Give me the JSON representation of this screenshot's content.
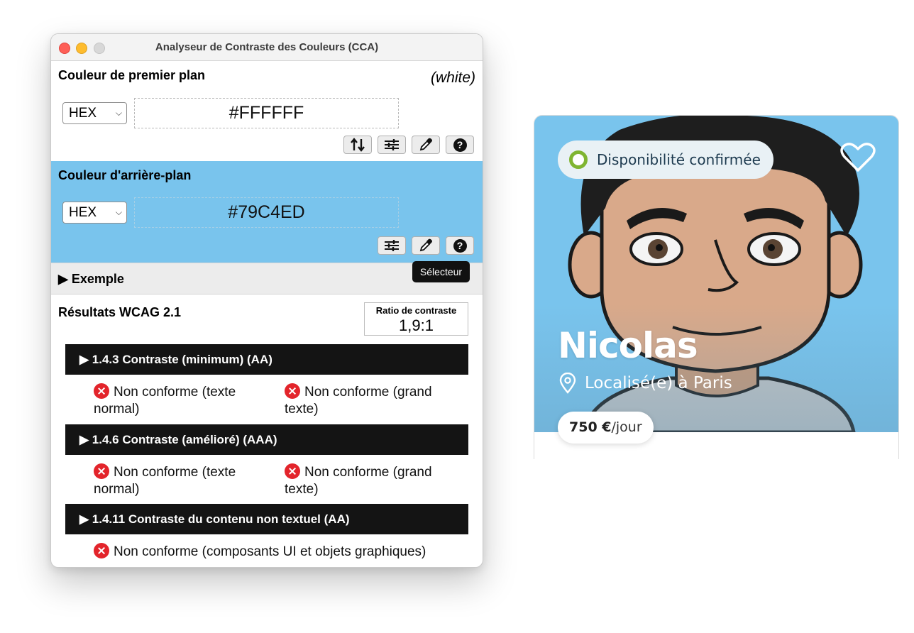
{
  "window": {
    "title": "Analyseur de Contraste des Couleurs (CCA)"
  },
  "foreground": {
    "label": "Couleur de premier plan",
    "color_name": "(white)",
    "format": "HEX",
    "value": "#FFFFFF",
    "color": "#ffffff"
  },
  "background": {
    "label": "Couleur d'arrière-plan",
    "format": "HEX",
    "value": "#79C4ED",
    "color": "#79c4ed"
  },
  "tools": {
    "swap_icon": "swap-arrows-icon",
    "sliders_icon": "sliders-icon",
    "picker_icon": "eyedropper-icon",
    "help_glyph": "?"
  },
  "tooltip": "Sélecteur",
  "example": {
    "label": "Exemple"
  },
  "results": {
    "title": "Résultats WCAG 2.1",
    "ratio_label": "Ratio de contraste",
    "ratio_value": "1,9:1",
    "criteria": [
      {
        "title": "1.4.3 Contraste (minimum) (AA)",
        "left": "Non conforme (texte normal)",
        "right": "Non conforme (grand texte)"
      },
      {
        "title": "1.4.6 Contraste (amélioré) (AAA)",
        "left": "Non conforme (texte normal)",
        "right": "Non conforme (grand texte)"
      },
      {
        "title": "1.4.11 Contraste du contenu non textuel (AA)",
        "full": "Non conforme (composants UI et objets graphiques)"
      }
    ]
  },
  "card": {
    "badge": "Disponibilité confirmée",
    "name": "Nicolas",
    "location": "Localisé(e) à Paris",
    "price_amount": "750 €",
    "price_unit": "/jour",
    "background_color": "#79c4ed",
    "badge_accent": "#7fb531"
  }
}
